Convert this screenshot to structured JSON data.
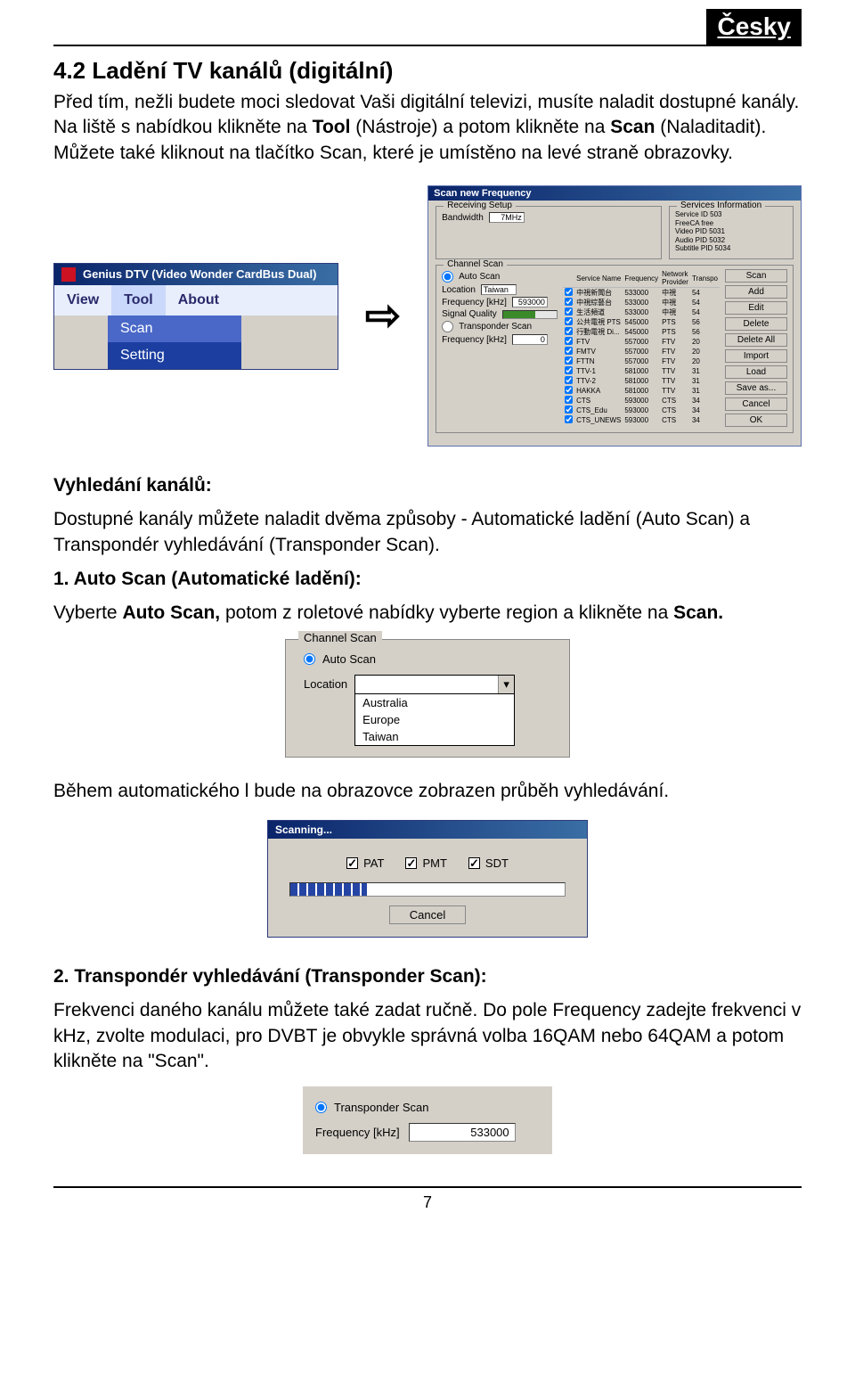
{
  "lang_badge": "Česky",
  "section_title": "4.2 Ladění TV kanálů (digitální)",
  "intro_prefix": "Před tím, nežli budete moci sledovat Vaši digitální televizi, musíte naladit dostupné kanály.\nNa liště s nabídkou klikněte na ",
  "intro_tool": "Tool",
  "intro_mid": " (Nástroje) a potom klikněte na ",
  "intro_scan": "Scan",
  "intro_after": " (Naladitadit). Můžete také kliknout na tlačítko Scan, které je umístěno na levé straně obrazovky.",
  "menu_window": {
    "title": "Genius DTV (Video Wonder CardBus Dual)",
    "menubar": [
      "View",
      "Tool",
      "About"
    ],
    "dropdown": [
      "Scan",
      "Setting"
    ],
    "dropdown_selected_index": 1
  },
  "arrow": "⇨",
  "scan_window": {
    "title": "Scan new Frequency",
    "receive_legend": "Receiving Setup",
    "bandwidth_label": "Bandwidth",
    "bandwidth_value": "7MHz",
    "svcinfo_legend": "Services Information",
    "svc_rows": [
      {
        "k": "Service ID",
        "v": "503"
      },
      {
        "k": "FreeCA",
        "v": "free"
      },
      {
        "k": "Video PID",
        "v": "5031"
      },
      {
        "k": "Audio PID",
        "v": "5032"
      },
      {
        "k": "Subtitle PID",
        "v": "5034"
      }
    ],
    "chscan_legend": "Channel Scan",
    "autoscan_label": "Auto Scan",
    "location_label": "Location",
    "location_value": "Taiwan",
    "freq_label": "Frequency [kHz]",
    "freq_value": "593000",
    "signal_label": "Signal Quality",
    "tpscan_label": "Transponder Scan",
    "tp_freq_value": "0",
    "table_headers": [
      "",
      "Service Name",
      "Frequency",
      "Network Provider",
      "Transpo"
    ],
    "table_rows": [
      [
        "中視新聞台",
        "533000",
        "中視",
        "54"
      ],
      [
        "中視綜藝台",
        "533000",
        "中視",
        "54"
      ],
      [
        "生活頻道",
        "533000",
        "中視",
        "54"
      ],
      [
        "公共電視 PTS",
        "545000",
        "PTS",
        "56"
      ],
      [
        "行動電視 Di...",
        "545000",
        "PTS",
        "56"
      ],
      [
        "FTV",
        "557000",
        "FTV",
        "20"
      ],
      [
        "FMTV",
        "557000",
        "FTV",
        "20"
      ],
      [
        "FTTN",
        "557000",
        "FTV",
        "20"
      ],
      [
        "TTV-1",
        "581000",
        "TTV",
        "31"
      ],
      [
        "TTV-2",
        "581000",
        "TTV",
        "31"
      ],
      [
        "HAKKA",
        "581000",
        "TTV",
        "31"
      ],
      [
        "CTS",
        "593000",
        "CTS",
        "34"
      ],
      [
        "CTS_Edu",
        "593000",
        "CTS",
        "34"
      ],
      [
        "CTS_UNEWS",
        "593000",
        "CTS",
        "34"
      ]
    ],
    "buttons": [
      "Scan",
      "Add",
      "Edit",
      "Delete",
      "Delete All",
      "Import",
      "Load",
      "Save as...",
      "Cancel",
      "OK"
    ]
  },
  "search_heading": "Vyhledání kanálů:",
  "search_body": "Dostupné kanály můžete naladit dvěma způsoby - Automatické ladění (Auto Scan) a Transpondér vyhledávání (Transponder Scan).",
  "autoscan_heading": "1. Auto Scan (Automatické ladění):",
  "autoscan_body_a": "Vyberte ",
  "autoscan_body_b": "Auto Scan,",
  "autoscan_body_c": " potom z roletové nabídky vyberte region a klikněte na ",
  "autoscan_body_d": "Scan.",
  "chscan_group": {
    "legend": "Channel Scan",
    "radio_label": "Auto Scan",
    "location_label": "Location",
    "options": [
      "Australia",
      "Europe",
      "Taiwan"
    ]
  },
  "progress_text": "Během automatického l bude na obrazovce zobrazen průběh vyhledávání.",
  "scanning_dialog": {
    "title": "Scanning...",
    "checks": [
      "PAT",
      "PMT",
      "SDT"
    ],
    "cancel": "Cancel"
  },
  "tp_heading": "2. Transpondér vyhledávání (Transponder Scan):",
  "tp_body": "Frekvenci daného kanálu můžete také zadat ručně. Do pole Frequency zadejte frekvenci v kHz, zvolte modulaci, pro DVBT je obvykle správná volba 16QAM nebo 64QAM a potom klikněte na \"Scan\".",
  "tp_box": {
    "radio_label": "Transponder Scan",
    "freq_label": "Frequency [kHz]",
    "freq_value": "533000"
  },
  "page_num": "7"
}
